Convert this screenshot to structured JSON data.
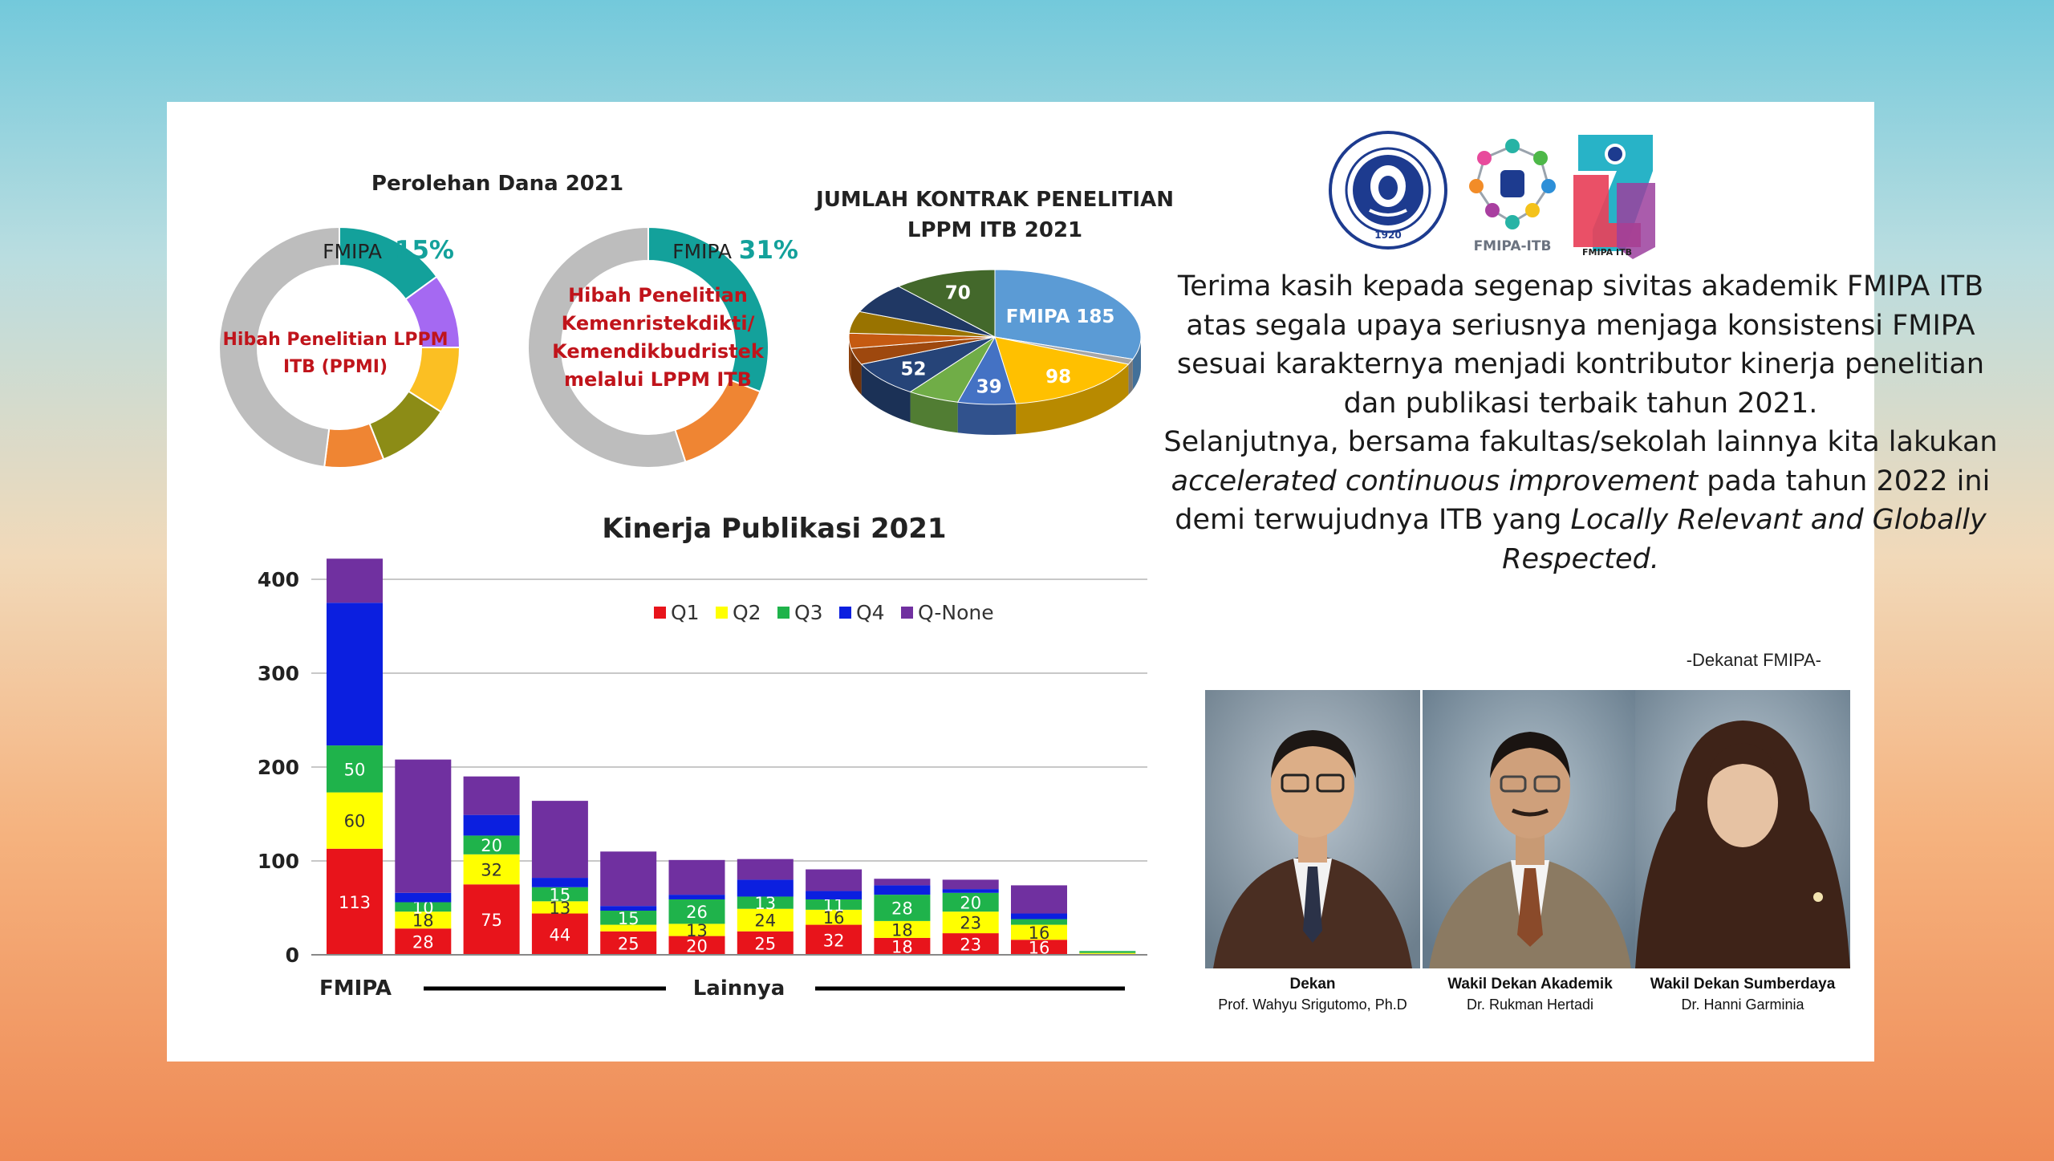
{
  "funding": {
    "title": "Perolehan Dana 2021",
    "donut1": {
      "label": "FMIPA",
      "pct": "15%",
      "center_line1": "Hibah Penelitian LPPM",
      "center_line2": "ITB (PPMI)"
    },
    "donut2": {
      "label": "FMIPA",
      "pct": "31%",
      "center_line1": "Hibah Penelitian",
      "center_line2": "Kemenristekdikti/",
      "center_line3": "Kemendikbudristek",
      "center_line4": "melalui LPPM ITB"
    }
  },
  "contracts": {
    "title_line1": "JUMLAH KONTRAK PENELITIAN",
    "title_line2": "LPPM ITB 2021"
  },
  "logos": {
    "itb_text": "INSTITUT TEKNOLOGI BANDUNG",
    "itb_year": "1920",
    "fmipa": "FMIPA-ITB",
    "anniv_small": "FMIPA ITB"
  },
  "message": {
    "p1": "Terima kasih kepada segenap sivitas akademik FMIPA ITB atas segala upaya seriusnya menjaga konsistensi FMIPA sesuai karakternya menjadi kontributor kinerja penelitian dan publikasi terbaik tahun 2021.",
    "p2a": "Selanjutnya, bersama fakultas/sekolah lainnya kita lakukan ",
    "p2b": "accelerated continuous improvement",
    "p2c": " pada tahun 2022 ini demi terwujudnya ITB yang ",
    "p2d": "Locally Relevant and Globally Respected.",
    "sign": "-Dekanat FMIPA-"
  },
  "people": [
    {
      "role": "Dekan",
      "name": "Prof. Wahyu Srigutomo, Ph.D"
    },
    {
      "role": "Wakil Dekan Akademik",
      "name": "Dr. Rukman Hertadi"
    },
    {
      "role": "Wakil Dekan Sumberdaya",
      "name": "Dr. Hanni Garminia"
    }
  ],
  "colors": {
    "q1": "#e8141b",
    "q2": "#ffff00",
    "q3": "#1fb34b",
    "q4": "#0b1fe0",
    "qnone": "#7030a0",
    "teal": "#13a19b",
    "accent_red": "#c0141b"
  },
  "chart_data": [
    {
      "type": "pie",
      "variant": "donut",
      "slices": [
        {
          "label": "FMIPA",
          "value": 15,
          "color": "#13a19b"
        },
        {
          "value": 10,
          "color": "#a569f2"
        },
        {
          "value": 9,
          "color": "#fbbf23"
        },
        {
          "value": 10,
          "color": "#8c8c16"
        },
        {
          "value": 8,
          "color": "#ef8533"
        },
        {
          "value": 48,
          "color": "#bdbdbd"
        }
      ]
    },
    {
      "type": "pie",
      "variant": "donut",
      "slices": [
        {
          "label": "FMIPA",
          "value": 31,
          "color": "#13a19b"
        },
        {
          "value": 14,
          "color": "#ef8533"
        },
        {
          "value": 55,
          "color": "#bdbdbd"
        }
      ]
    },
    {
      "type": "pie",
      "variant": "3d",
      "slices": [
        {
          "label": "FMIPA",
          "value": 185,
          "display": "FMIPA 185",
          "color": "#5b9bd5"
        },
        {
          "value": 8,
          "display": "",
          "color": "#a6a6a6"
        },
        {
          "value": 98,
          "display": "98",
          "color": "#ffc000"
        },
        {
          "value": 39,
          "display": "39",
          "color": "#4472c4"
        },
        {
          "value": 35,
          "display": "",
          "color": "#70ad47"
        },
        {
          "value": 52,
          "display": "52",
          "color": "#264478"
        },
        {
          "value": 24,
          "display": "",
          "color": "#9e480e"
        },
        {
          "value": 22,
          "display": "",
          "color": "#c55a11"
        },
        {
          "value": 32,
          "display": "",
          "color": "#997300"
        },
        {
          "value": 45,
          "display": "",
          "color": "#203864"
        },
        {
          "value": 70,
          "display": "70",
          "color": "#43682b"
        }
      ]
    },
    {
      "type": "bar",
      "stacked": true,
      "title": "Kinerja Publikasi 2021",
      "ylim": [
        0,
        400
      ],
      "yticks": [
        "0",
        "100",
        "200",
        "300",
        "400"
      ],
      "grid": true,
      "legend": "top-right",
      "group_labels": {
        "first": "FMIPA",
        "rest": "Lainnya"
      },
      "series": [
        {
          "name": "Q1",
          "color": "#e8141b",
          "values": [
            113,
            28,
            75,
            44,
            25,
            20,
            25,
            32,
            18,
            23,
            16,
            1
          ],
          "labels": [
            "113",
            "28",
            "75",
            "44",
            "25",
            "20",
            "25",
            "32",
            "18",
            "23",
            "16",
            ""
          ]
        },
        {
          "name": "Q2",
          "color": "#ffff00",
          "values": [
            60,
            18,
            32,
            13,
            7,
            13,
            24,
            16,
            18,
            23,
            16,
            1
          ],
          "labels": [
            "60",
            "18",
            "32",
            "13",
            "7",
            "13",
            "24",
            "16",
            "18",
            "23",
            "16",
            ""
          ]
        },
        {
          "name": "Q3",
          "color": "#1fb34b",
          "values": [
            50,
            10,
            20,
            15,
            15,
            26,
            13,
            11,
            28,
            20,
            6,
            2
          ],
          "labels": [
            "50",
            "10",
            "20",
            "15",
            "15",
            "26",
            "13",
            "11",
            "28",
            "20",
            "6",
            "2"
          ]
        },
        {
          "name": "Q4",
          "color": "#0b1fe0",
          "values": [
            152,
            10,
            22,
            10,
            5,
            5,
            18,
            9,
            10,
            4,
            6,
            0
          ],
          "labels": [
            "",
            "",
            "",
            "",
            "",
            "",
            "",
            "",
            "",
            "",
            "",
            ""
          ]
        },
        {
          "name": "Q-None",
          "color": "#7030a0",
          "values": [
            47,
            142,
            41,
            82,
            58,
            37,
            22,
            23,
            7,
            10,
            30,
            0
          ],
          "labels": [
            "",
            "",
            "",
            "",
            "",
            "",
            "",
            "",
            "",
            "",
            "",
            ""
          ]
        }
      ]
    }
  ]
}
